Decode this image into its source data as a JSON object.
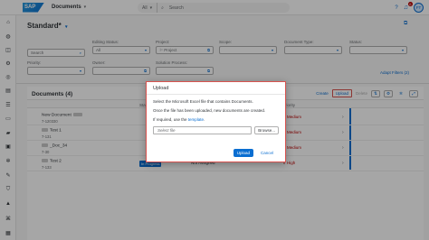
{
  "shell": {
    "logo": "SAP",
    "app_title": "Documents",
    "search_scope": "All",
    "search_placeholder": "Search",
    "notifications_count": "6",
    "avatar_initials": "FT"
  },
  "header": {
    "variant": "Standard",
    "variant_marker": "*"
  },
  "filters": {
    "search_placeholder": "Search",
    "editing_status": {
      "label": "Editing Status:",
      "value": "All"
    },
    "project": {
      "label": "Project:",
      "value": "Project"
    },
    "scope": {
      "label": "Scope:",
      "value": ""
    },
    "document_type": {
      "label": "Document Type:",
      "value": ""
    },
    "status": {
      "label": "Status:",
      "value": ""
    },
    "priority": {
      "label": "Priority:",
      "value": ""
    },
    "owner": {
      "label": "Owner:",
      "value": ""
    },
    "solution_process": {
      "label": "Solution Process:",
      "value": ""
    },
    "adapt_filters": "Adapt Filters (2)"
  },
  "table": {
    "title": "Documents (4)",
    "toolbar": {
      "create": "Create",
      "upload": "Upload",
      "delete": "Delete"
    },
    "columns": {
      "status": "Stat",
      "priority": "Priority"
    },
    "rows": [
      {
        "name": "New Document",
        "number": "7-120330",
        "status": "",
        "assigned": "",
        "priority": "Medium"
      },
      {
        "name": "Test 1",
        "number": "7-131",
        "status": "",
        "assigned": "",
        "priority": "Medium"
      },
      {
        "name": "_Doc_34",
        "number": "7-30",
        "status": "",
        "assigned": "",
        "priority": "Medium"
      },
      {
        "name": "Test 2",
        "number": "7-133",
        "status": "In Progress",
        "assigned": "Not Assigned",
        "priority": "High"
      }
    ]
  },
  "dialog": {
    "title": "Upload",
    "line1": "Select the Microsoft Excel file that contains Documents.",
    "line2": "Once the file has been uploaded, new documents are created.",
    "line3_prefix": "If required, use the",
    "line3_link": "template",
    "line3_suffix": ".",
    "file_placeholder": "Select file",
    "browse": "Browse...",
    "upload": "Upload",
    "cancel": "Cancel"
  },
  "colors": {
    "accent": "#0a6ed1",
    "negative": "#bb0000",
    "highlight_border": "#d9534f"
  }
}
